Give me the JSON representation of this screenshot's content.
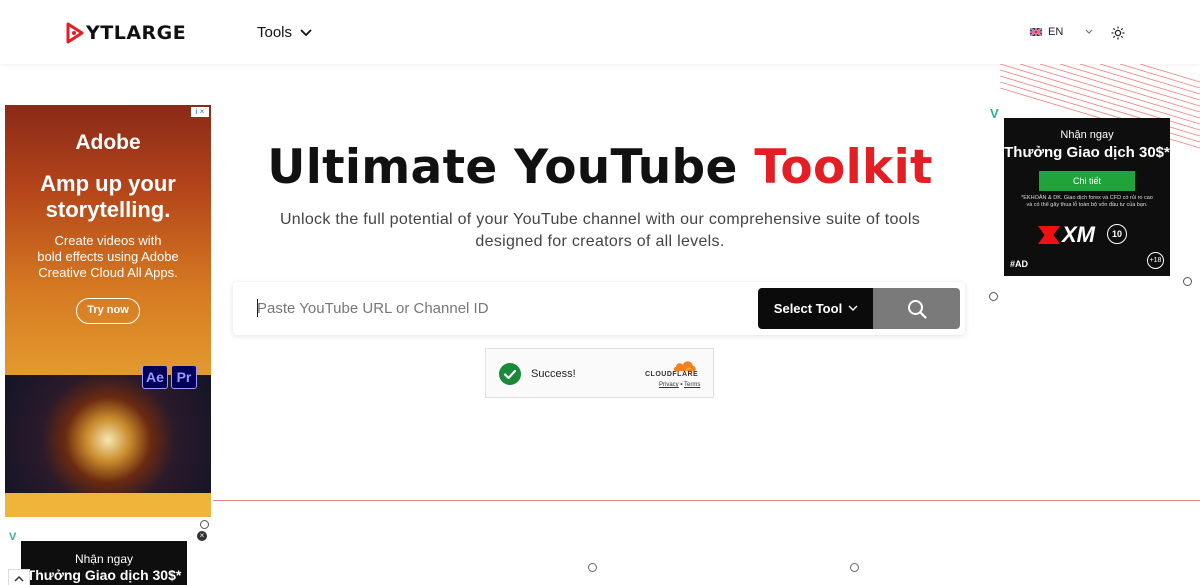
{
  "header": {
    "logo_text": "YTLARGE",
    "nav_tools_label": "Tools",
    "lang_label": "EN"
  },
  "hero": {
    "title_main": "Ultimate YouTube",
    "title_accent": "Toolkit",
    "subtitle_line1": "Unlock the full potential of your YouTube channel with our comprehensive suite of tools",
    "subtitle_line2": "designed for creators of all levels."
  },
  "search": {
    "placeholder": "Paste YouTube URL or Channel ID",
    "select_label": "Select Tool"
  },
  "cloudflare": {
    "status": "Success!",
    "brand": "CLOUDFLARE",
    "privacy": "Privacy",
    "separator": "•",
    "terms": "Terms"
  },
  "ad_left": {
    "brand": "Adobe",
    "headline_line1": "Amp up your",
    "headline_line2": "storytelling.",
    "sub_line1": "Create videos with",
    "sub_line2": "bold effects using Adobe",
    "sub_line3": "Creative Cloud All Apps.",
    "cta": "Try now",
    "app1": "Ae",
    "app2": "Pr"
  },
  "ad_right": {
    "line1": "Nhận ngay",
    "line2": "Thưởng Giao dịch 30$*",
    "button": "Chi tiết",
    "fine_print": "*EKHOẢN & DK. Giao dịch forex và CFD có rủi ro cao và có thể gây thua lỗ toàn bộ vốn đầu tư của bạn.",
    "brand": "XM",
    "badge": "10",
    "tag": "#AD",
    "age": "+18"
  },
  "ad_bottom_left": {
    "line1": "Nhận ngay",
    "line2": "Thưởng Giao dịch 30$*"
  },
  "colors": {
    "accent": "#e31e24",
    "select_bg": "#0b0b0b",
    "search_btn_bg": "#7a7a7a",
    "success": "#1a8a3a"
  }
}
